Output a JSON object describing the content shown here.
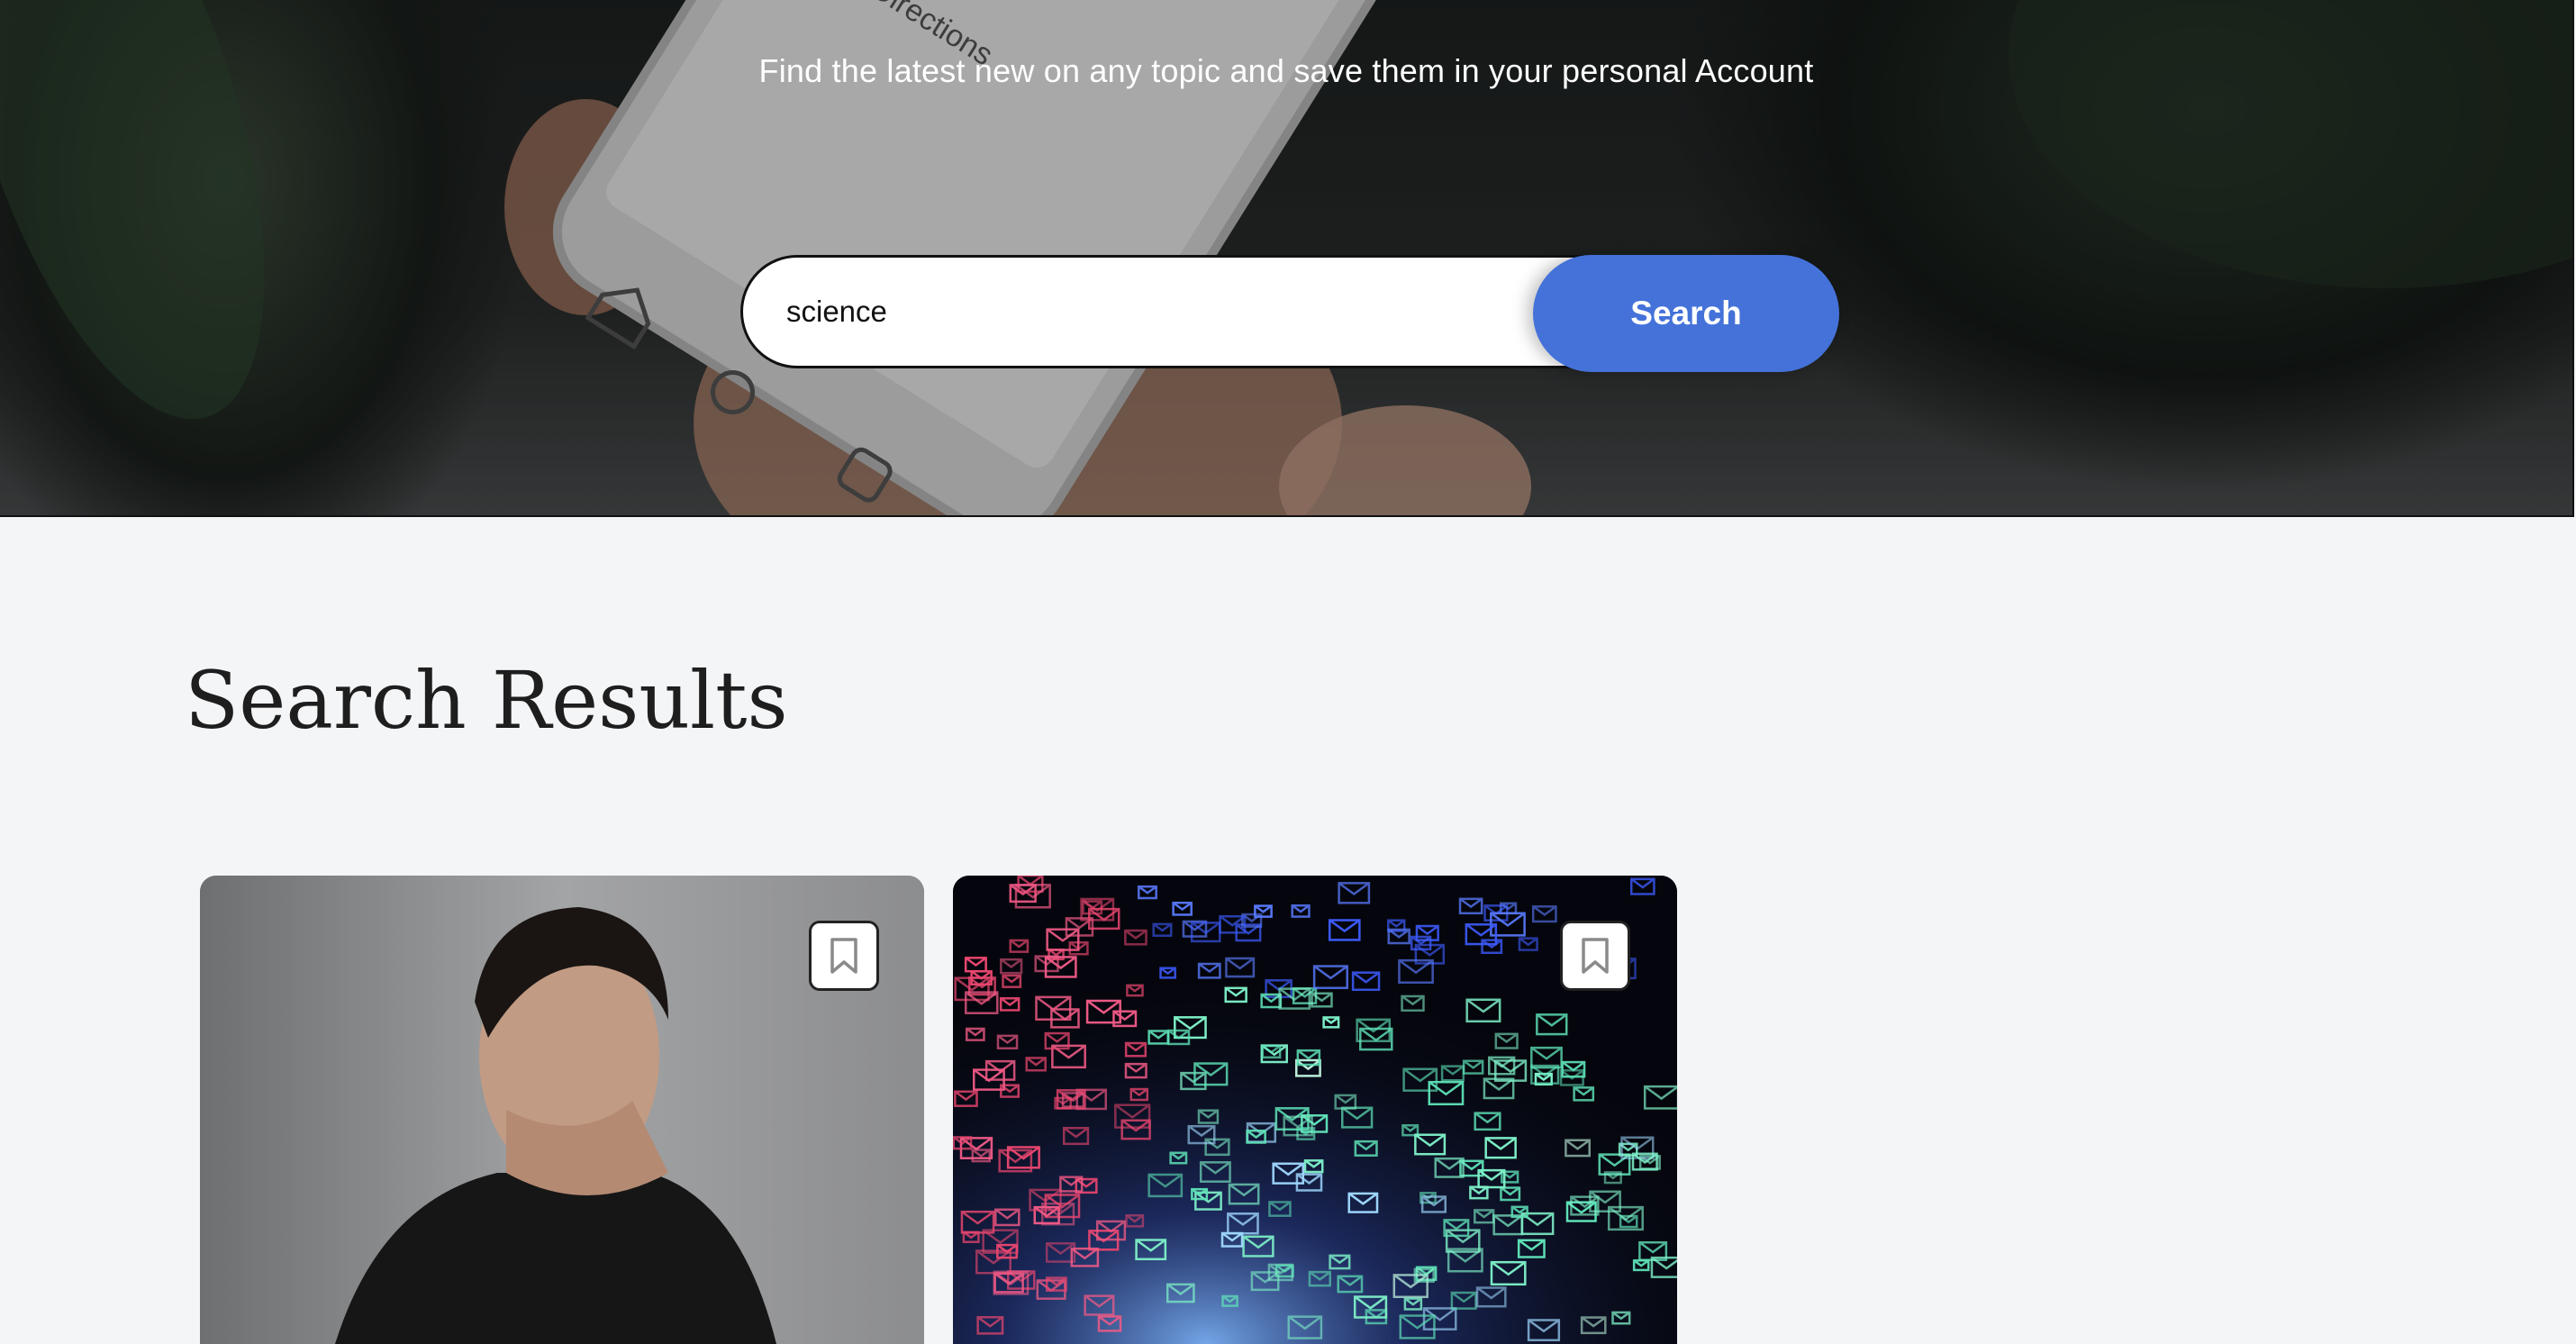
{
  "hero": {
    "tagline": "Find the latest new on any topic and save them in your personal Account",
    "background_image": "hand-holding-smartphone-analytics-photo"
  },
  "search": {
    "value": "science",
    "placeholder": "",
    "button_label": "Search"
  },
  "results": {
    "title": "Search Results",
    "cards": [
      {
        "image": "man-covering-face-photo",
        "bookmark_icon": "bookmark-icon"
      },
      {
        "image": "email-envelopes-burst-photo",
        "bookmark_icon": "bookmark-icon"
      }
    ]
  },
  "colors": {
    "accent": "#4472d9",
    "page_background": "#f4f5f7",
    "title_text": "#1e1e1e"
  }
}
